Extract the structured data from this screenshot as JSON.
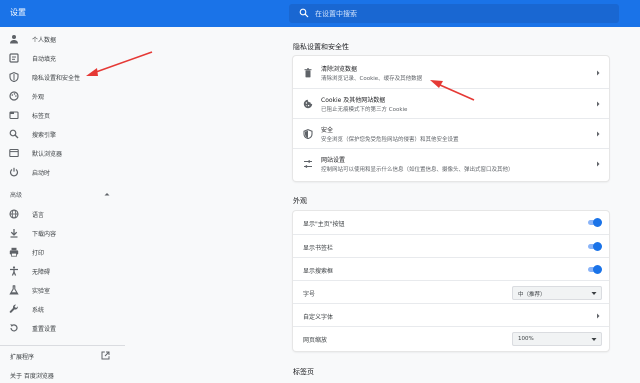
{
  "app": {
    "title": "设置"
  },
  "search": {
    "placeholder": "在设置中搜索"
  },
  "sidebar": {
    "items": [
      {
        "label": "个人数据",
        "icon": "person-icon"
      },
      {
        "label": "自动填充",
        "icon": "autofill-icon"
      },
      {
        "label": "隐私设置和安全性",
        "icon": "shield-icon"
      },
      {
        "label": "外观",
        "icon": "palette-icon"
      },
      {
        "label": "标签页",
        "icon": "tab-icon"
      },
      {
        "label": "搜索引擎",
        "icon": "search-icon"
      },
      {
        "label": "默认浏览器",
        "icon": "browser-icon"
      },
      {
        "label": "启动时",
        "icon": "power-icon"
      }
    ],
    "advanced_label": "高级",
    "advanced_items": [
      {
        "label": "语言",
        "icon": "globe-icon"
      },
      {
        "label": "下载内容",
        "icon": "download-icon"
      },
      {
        "label": "打印",
        "icon": "printer-icon"
      },
      {
        "label": "无障碍",
        "icon": "accessibility-icon"
      },
      {
        "label": "实验室",
        "icon": "flask-icon"
      },
      {
        "label": "系统",
        "icon": "wrench-icon"
      },
      {
        "label": "重置设置",
        "icon": "reset-icon"
      }
    ],
    "extensions_label": "扩展程序",
    "about_label": "关于 百度浏览器"
  },
  "privacy": {
    "section_title": "隐私设置和安全性",
    "rows": [
      {
        "title": "清除浏览数据",
        "subtitle": "清除浏览记录、Cookie、缓存及其他数据",
        "icon": "trash-icon"
      },
      {
        "title": "Cookie 及其他网站数据",
        "subtitle": "已阻止无痕模式下的第三方 Cookie",
        "icon": "cookie-icon"
      },
      {
        "title": "安全",
        "subtitle": "安全浏览（保护您免受危险网站的侵害）和其他安全设置",
        "icon": "security-shield-icon"
      },
      {
        "title": "网站设置",
        "subtitle": "控制网站可以使用和显示什么信息（如位置信息、摄像头、弹出式窗口及其他）",
        "icon": "sliders-icon"
      }
    ]
  },
  "appearance": {
    "section_title": "外观",
    "rows": [
      {
        "label": "显示\"主页\"按钮",
        "type": "toggle",
        "on": true
      },
      {
        "label": "显示书签栏",
        "type": "toggle",
        "on": true
      },
      {
        "label": "显示搜索框",
        "type": "toggle",
        "on": true
      },
      {
        "label": "字号",
        "type": "select",
        "value": "中（推荐）"
      },
      {
        "label": "自定义字体",
        "type": "link"
      },
      {
        "label": "网页缩放",
        "type": "select",
        "value": "100%"
      }
    ]
  },
  "tabs_section": {
    "title": "标签页"
  },
  "colors": {
    "header": "#1a73e8",
    "accent": "#1a73e8",
    "annotation_arrow": "#e53935"
  }
}
